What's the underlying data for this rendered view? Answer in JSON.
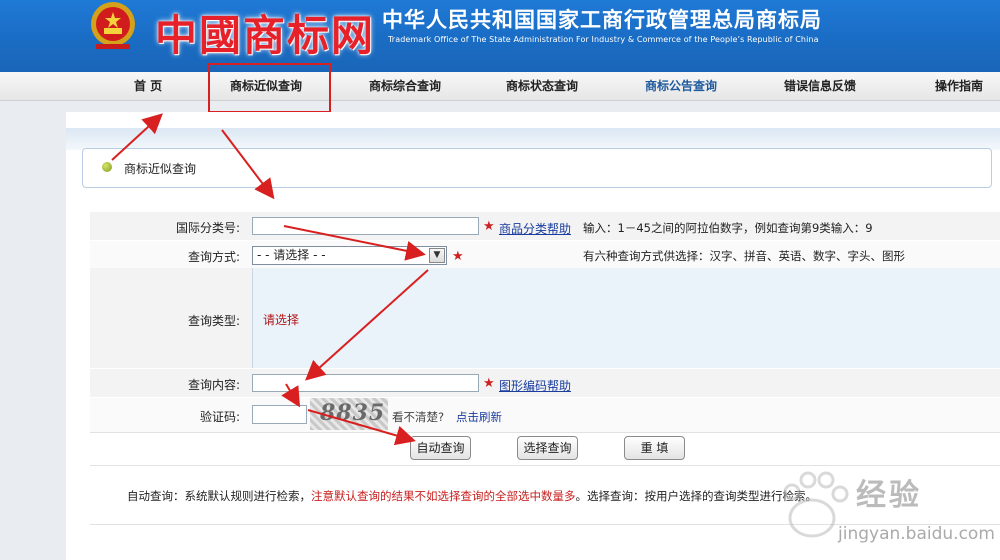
{
  "header": {
    "brand": "中國商标网",
    "office_cn": "中华人民共和国国家工商行政管理总局商标局",
    "office_en": "Trademark Office of The State Administration For Industry & Commerce of the People’s Republic of China"
  },
  "nav": {
    "items": [
      "首 页",
      "商标近似查询",
      "商标综合查询",
      "商标状态查询",
      "商标公告查询",
      "错误信息反馈",
      "操作指南"
    ]
  },
  "breadcrumb": {
    "label": "商标近似查询"
  },
  "form": {
    "class_label": "国际分类号:",
    "class_help": "商品分类帮助",
    "class_hint": "输入：1－45之间的阿拉伯数字，例如查询第9类输入：9",
    "method_label": "查询方式:",
    "method_selected": "- - 请选择 - -",
    "method_hint": "有六种查询方式供选择：汉字、拼音、英语、数字、字头、图形",
    "type_label": "查询类型:",
    "type_hint": "请选择",
    "content_label": "查询内容:",
    "content_help": "图形编码帮助",
    "captcha_label": "验证码:",
    "captcha_code": "8835",
    "captcha_unclear": "看不清楚?",
    "captcha_refresh": "点击刷新",
    "star": "★"
  },
  "buttons": {
    "auto": "自动查询",
    "select": "选择查询",
    "reset": "重 填"
  },
  "footnote": {
    "part1": "自动查询：系统默认规则进行检索，",
    "part2": "注意默认查询的结果不如选择查询的全部选中数量多",
    "part3": "。选择查询：按用户选择的查询类型进行检索。"
  },
  "watermark": {
    "text": "经验",
    "url": "jingyan.baidu.com"
  },
  "colors": {
    "header_blue": "#1a6cc4",
    "annotation_red": "#d92020",
    "required_star": "#cc2222",
    "link_blue": "#1a3d9e"
  }
}
